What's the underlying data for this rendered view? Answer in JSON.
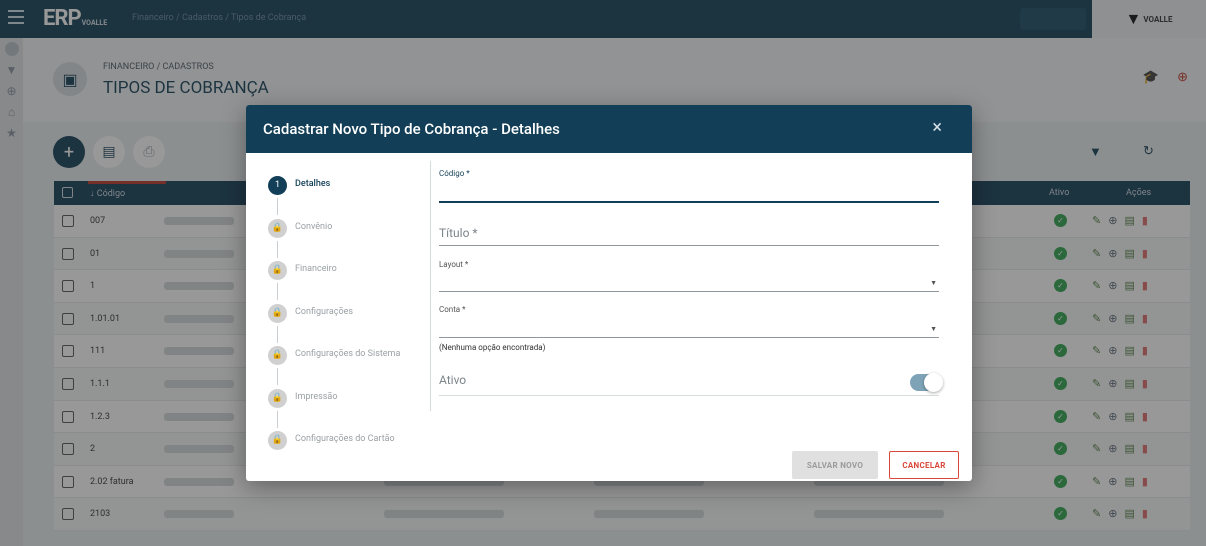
{
  "app": {
    "logo": "ERP",
    "logo_sub": "VOALLE",
    "breadcrumb_top": "Financeiro / Cadastros / Tipos de Cobrança",
    "brand": "VOALLE"
  },
  "page": {
    "breadcrumb": "FINANCEIRO / CADASTROS",
    "title": "TIPOS DE COBRANÇA"
  },
  "table": {
    "col_code": "↓ Código",
    "col_active": "Ativo",
    "col_actions": "Ações",
    "rows": [
      "007",
      "01",
      "1",
      "1.01.01",
      "111",
      "1.1.1",
      "1.2.3",
      "2",
      "2.02 fatura",
      "2103"
    ]
  },
  "modal": {
    "title": "Cadastrar Novo Tipo de Cobrança - Detalhes",
    "close": "×",
    "steps": [
      {
        "num": "1",
        "label": "Detalhes"
      },
      {
        "num": "🔒",
        "label": "Convênio"
      },
      {
        "num": "🔒",
        "label": "Financeiro"
      },
      {
        "num": "🔒",
        "label": "Configurações"
      },
      {
        "num": "🔒",
        "label": "Configurações do Sistema"
      },
      {
        "num": "🔒",
        "label": "Impressão"
      },
      {
        "num": "🔒",
        "label": "Configurações do Cartão"
      }
    ],
    "fields": {
      "codigo_label": "Código *",
      "titulo_placeholder": "Título *",
      "layout_label": "Layout *",
      "conta_label": "Conta *",
      "conta_hint": "(Nenhuma opção encontrada)",
      "ativo_label": "Ativo",
      "ativo_on": true
    },
    "buttons": {
      "save": "SALVAR NOVO",
      "cancel": "CANCELAR"
    }
  }
}
